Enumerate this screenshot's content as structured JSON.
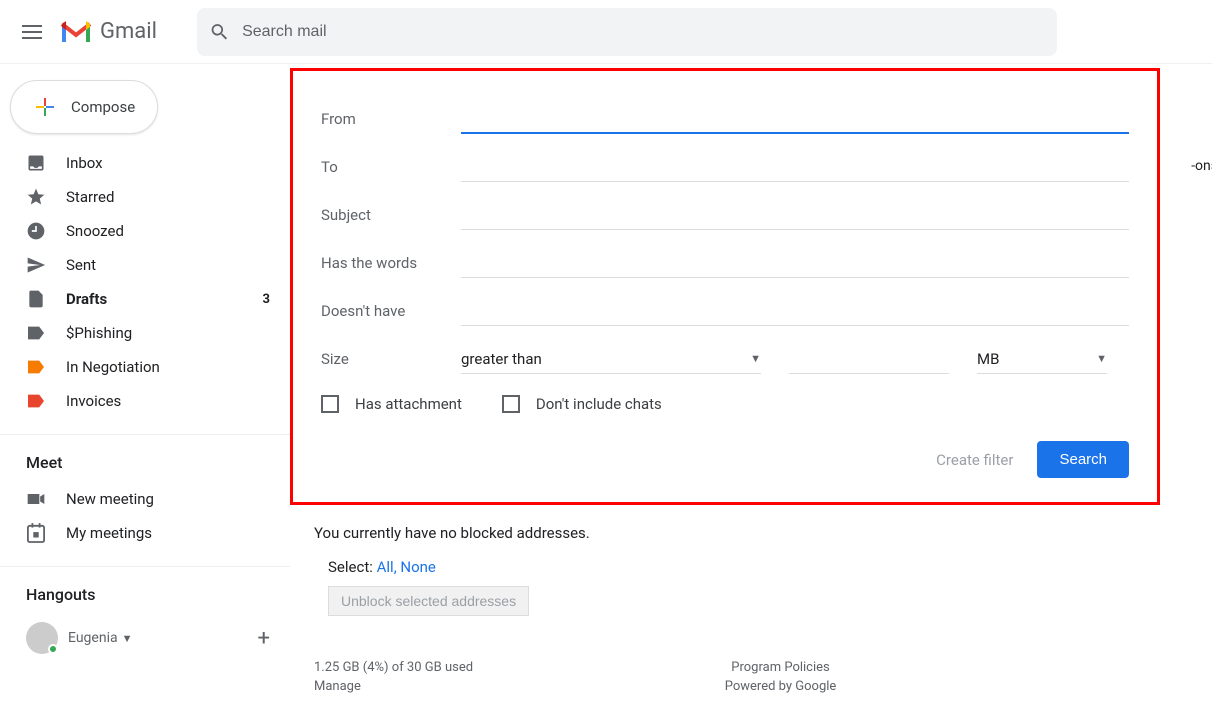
{
  "header": {
    "logo_text": "Gmail",
    "search_placeholder": "Search mail"
  },
  "sidebar": {
    "compose_label": "Compose",
    "items": [
      {
        "label": "Inbox",
        "count": ""
      },
      {
        "label": "Starred",
        "count": ""
      },
      {
        "label": "Snoozed",
        "count": ""
      },
      {
        "label": "Sent",
        "count": ""
      },
      {
        "label": "Drafts",
        "count": "3"
      },
      {
        "label": "$Phishing",
        "count": ""
      },
      {
        "label": "In Negotiation",
        "count": ""
      },
      {
        "label": "Invoices",
        "count": ""
      }
    ],
    "meet_title": "Meet",
    "meet_items": [
      {
        "label": "New meeting"
      },
      {
        "label": "My meetings"
      }
    ],
    "hangouts_title": "Hangouts",
    "hangouts_user": "Eugenia"
  },
  "filter": {
    "from_label": "From",
    "to_label": "To",
    "subject_label": "Subject",
    "haswords_label": "Has the words",
    "doesnthave_label": "Doesn't have",
    "size_label": "Size",
    "size_operator": "greater than",
    "size_unit": "MB",
    "has_attachment_label": "Has attachment",
    "dont_include_chats_label": "Don't include chats",
    "create_filter_label": "Create filter",
    "search_label": "Search"
  },
  "blocked": {
    "message": "You currently have no blocked addresses.",
    "select_label": "Select:",
    "all_label": "All",
    "none_label": "None",
    "unblock_label": "Unblock selected addresses"
  },
  "footer": {
    "storage": "1.25 GB (4%) of 30 GB used",
    "manage": "Manage",
    "policies": "Program Policies",
    "powered": "Powered by Google"
  },
  "addons_fragment": "-ons"
}
